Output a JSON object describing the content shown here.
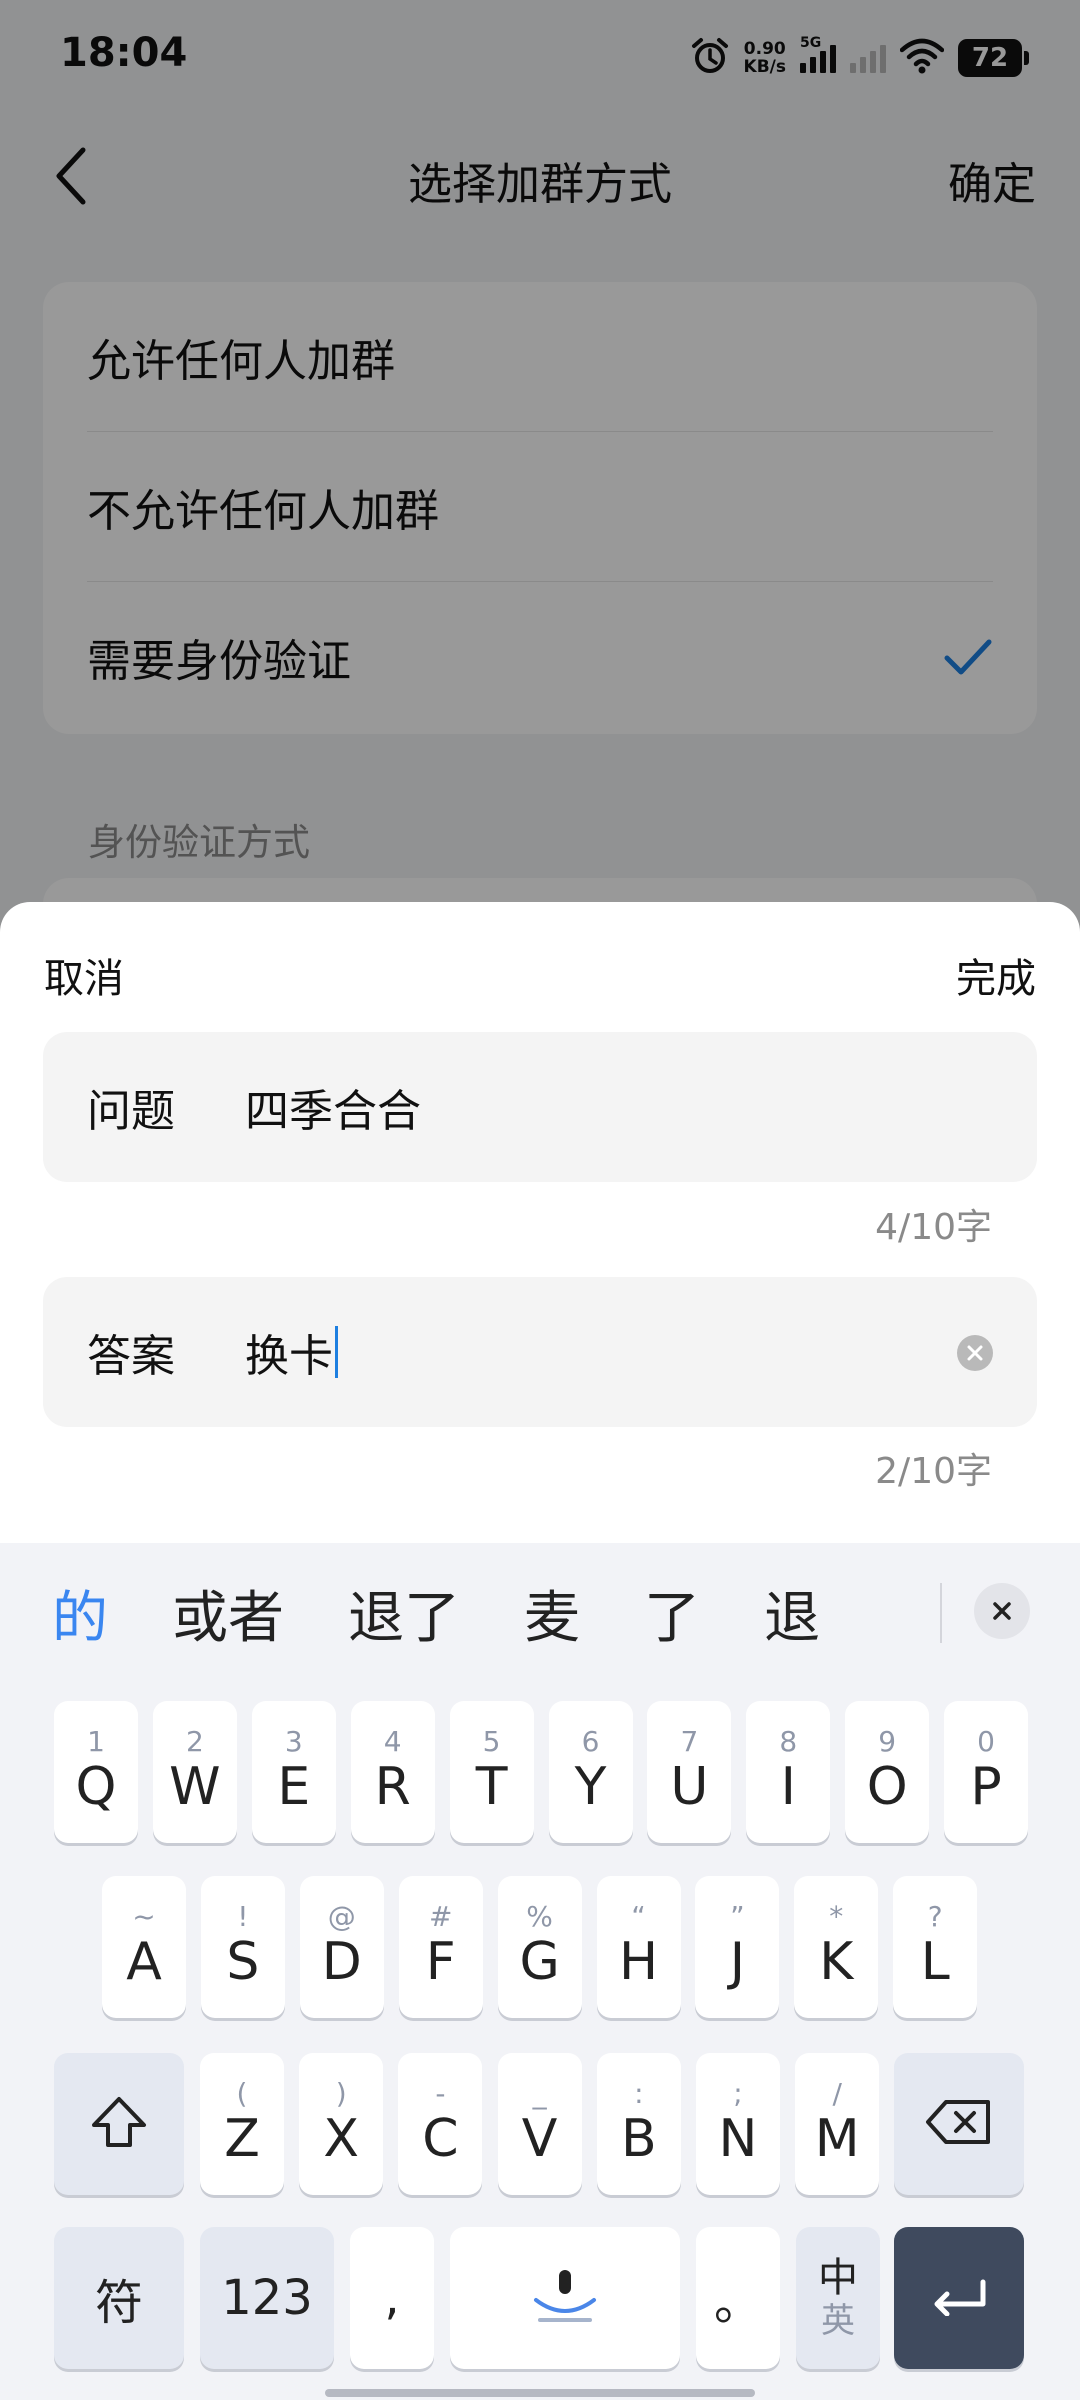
{
  "status": {
    "time": "18:04",
    "speed_value": "0.90",
    "speed_unit": "KB/s",
    "network": "5G",
    "battery": "72",
    "icons": [
      "alarm-icon",
      "signal-icon",
      "wifi-icon",
      "battery-icon"
    ]
  },
  "nav": {
    "title": "选择加群方式",
    "confirm": "确定",
    "back_icon": "chevron-left-icon"
  },
  "options": [
    {
      "label": "允许任何人加群",
      "selected": false
    },
    {
      "label": "不允许任何人加群",
      "selected": false
    },
    {
      "label": "需要身份验证",
      "selected": true
    }
  ],
  "accent_color": "#1d7fe0",
  "section_label": "身份验证方式",
  "sheet": {
    "cancel": "取消",
    "done": "完成",
    "question": {
      "label": "问题",
      "value": "四季合合",
      "counter": "4/10字"
    },
    "answer": {
      "label": "答案",
      "value": "换卡",
      "counter": "2/10字"
    }
  },
  "keyboard": {
    "candidates": [
      "的",
      "或者",
      "退了",
      "麦",
      "了",
      "退"
    ],
    "row1": [
      {
        "hint": "1",
        "key": "Q"
      },
      {
        "hint": "2",
        "key": "W"
      },
      {
        "hint": "3",
        "key": "E"
      },
      {
        "hint": "4",
        "key": "R"
      },
      {
        "hint": "5",
        "key": "T"
      },
      {
        "hint": "6",
        "key": "Y"
      },
      {
        "hint": "7",
        "key": "U"
      },
      {
        "hint": "8",
        "key": "I"
      },
      {
        "hint": "9",
        "key": "O"
      },
      {
        "hint": "0",
        "key": "P"
      }
    ],
    "row2": [
      {
        "hint": "~",
        "key": "A"
      },
      {
        "hint": "!",
        "key": "S"
      },
      {
        "hint": "@",
        "key": "D"
      },
      {
        "hint": "#",
        "key": "F"
      },
      {
        "hint": "%",
        "key": "G"
      },
      {
        "hint": "“",
        "key": "H"
      },
      {
        "hint": "”",
        "key": "J"
      },
      {
        "hint": "*",
        "key": "K"
      },
      {
        "hint": "?",
        "key": "L"
      }
    ],
    "row3": [
      {
        "hint": "(",
        "key": "Z"
      },
      {
        "hint": ")",
        "key": "X"
      },
      {
        "hint": "-",
        "key": "C"
      },
      {
        "hint": "_",
        "key": "V"
      },
      {
        "hint": ":",
        "key": "B"
      },
      {
        "hint": ";",
        "key": "N"
      },
      {
        "hint": "/",
        "key": "M"
      }
    ],
    "symbol_key": "符",
    "number_key": "123",
    "comma_key": ",",
    "period_key": "。",
    "lang_key_main": "中",
    "lang_key_sub": "英"
  }
}
